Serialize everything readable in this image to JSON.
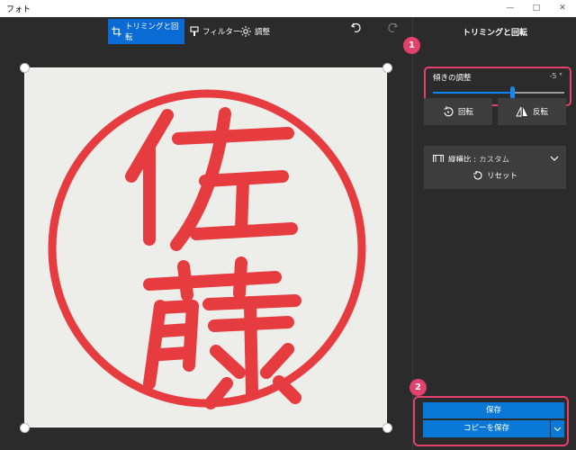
{
  "window": {
    "title": "フォト"
  },
  "toolbar": {
    "crop_label": "トリミングと回転",
    "filter_label": "フィルター",
    "adjust_label": "調整"
  },
  "panel": {
    "title": "トリミングと回転",
    "straighten": {
      "label": "傾きの調整",
      "value_text": "-5 °",
      "level_percent": 60
    },
    "rotate_label": "回転",
    "flip_label": "反転",
    "aspect_label": "縦横比 :",
    "aspect_value": "カスタム",
    "reset_label": "リセット",
    "save_label": "保存",
    "save_copy_label": "コピーを保存"
  },
  "annotations": {
    "badge1": "1",
    "badge2": "2"
  },
  "colors": {
    "accent": "#0a78d7",
    "annotation": "#e2416b",
    "stamp_red": "#e63b3f"
  }
}
